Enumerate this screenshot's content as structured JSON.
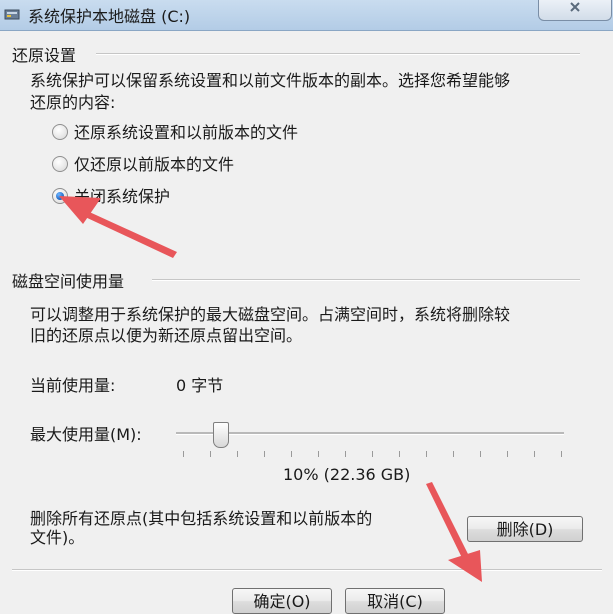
{
  "window": {
    "title": "系统保护本地磁盘 (C:)"
  },
  "restore": {
    "heading": "还原设置",
    "description_line1": "系统保护可以保留系统设置和以前文件版本的副本。选择您希望能够",
    "description_line2": "还原的内容:",
    "options": [
      {
        "label": "还原系统设置和以前版本的文件",
        "selected": false
      },
      {
        "label": "仅还原以前版本的文件",
        "selected": false
      },
      {
        "label": "关闭系统保护",
        "selected": true
      }
    ]
  },
  "disk": {
    "heading": "磁盘空间使用量",
    "description_line1": "可以调整用于系统保护的最大磁盘空间。占满空间时，系统将删除较",
    "description_line2": "旧的还原点以便为新还原点留出空间。",
    "current_label": "当前使用量:",
    "current_value": "0 字节",
    "max_label": "最大使用量(M):",
    "slider_fraction": 0.1,
    "slider_value_text": "10% (22.36 GB)"
  },
  "delete": {
    "text_line1": "删除所有还原点(其中包括系统设置和以前版本的",
    "text_line2": "文件)。",
    "button_label": "删除(D)"
  },
  "footer": {
    "ok_label": "确定(O)",
    "cancel_label": "取消(C)"
  },
  "colors": {
    "annotation_arrow": "#e8565a",
    "accent_radio": "#1a63c2"
  }
}
